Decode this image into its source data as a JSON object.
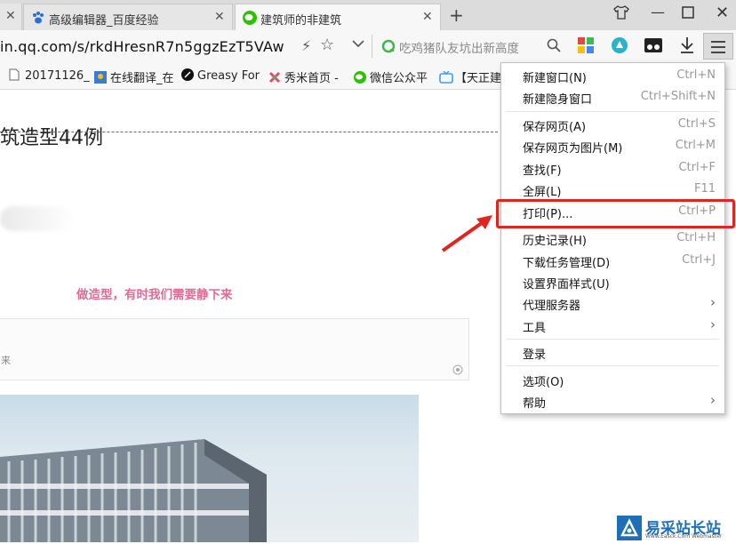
{
  "tabs": [
    {
      "title": "高级编辑器_百度经验",
      "active": false
    },
    {
      "title": "建筑师的非建筑",
      "active": true
    }
  ],
  "address_bar": {
    "url": "in.qq.com/s/rkdHresnR7n5ggzEzT5VAw"
  },
  "search": {
    "text": "吃鸡猪队友坑出新高度"
  },
  "bookmarks": [
    "20171126_",
    "在线翻译_在",
    "Greasy For",
    "秀米首页 -",
    "微信公众平",
    "【天正建"
  ],
  "page": {
    "title": "筑造型44例",
    "pink_text": "做造型，有时我们需要静下来",
    "quote_fragment": "来"
  },
  "menu": {
    "items": [
      {
        "label": "新建窗口(N)",
        "shortcut": "Ctrl+N"
      },
      {
        "label": "新建隐身窗口",
        "shortcut": "Ctrl+Shift+N"
      },
      {
        "label": "保存网页(A)",
        "shortcut": "Ctrl+S"
      },
      {
        "label": "保存网页为图片(M)",
        "shortcut": "Ctrl+M"
      },
      {
        "label": "查找(F)",
        "shortcut": "Ctrl+F"
      },
      {
        "label": "全屏(L)",
        "shortcut": "F11"
      },
      {
        "label": "打印(P)...",
        "shortcut": "Ctrl+P"
      },
      {
        "label": "历史记录(H)",
        "shortcut": "Ctrl+H"
      },
      {
        "label": "下载任务管理(D)",
        "shortcut": "Ctrl+J"
      },
      {
        "label": "设置界面样式(U)",
        "shortcut": ""
      },
      {
        "label": "代理服务器",
        "shortcut": ""
      },
      {
        "label": "工具",
        "shortcut": ""
      },
      {
        "label": "登录",
        "shortcut": ""
      },
      {
        "label": "选项(O)",
        "shortcut": ""
      },
      {
        "label": "帮助",
        "shortcut": ""
      }
    ]
  },
  "watermark": {
    "text": "易采站长站",
    "sub": "Www.Easck.Com Webmaster"
  },
  "colors": {
    "highlight": "#e0241e",
    "pink": "#e26b93",
    "wechat_green": "#2dc100"
  }
}
